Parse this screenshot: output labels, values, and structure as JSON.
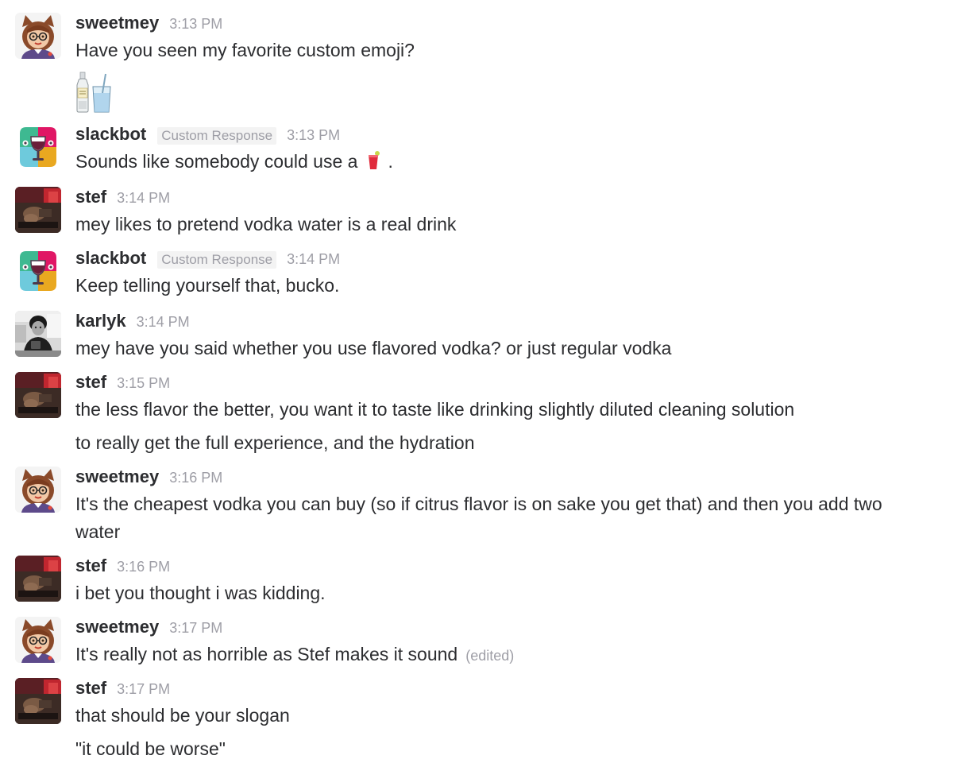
{
  "top_partial": {
    "text": ""
  },
  "messages": [
    {
      "author": "sweetmey",
      "time": "3:13 PM",
      "lines": [
        "Have you seen my favorite custom emoji?"
      ],
      "avatar_icon": "sweetmey-cat-avatar",
      "attachment_emoji": "vodka-water-emoji"
    },
    {
      "author": "slackbot",
      "badge": "Custom Response",
      "time": "3:13 PM",
      "text_before": "Sounds like somebody could use a",
      "inline_emoji": "cocktail-emoji",
      "text_after": ".",
      "avatar_icon": "slackbot-avatar"
    },
    {
      "author": "stef",
      "time": "3:14 PM",
      "lines": [
        "mey likes to pretend vodka water is a real drink"
      ],
      "avatar_icon": "stef-photo-avatar"
    },
    {
      "author": "slackbot",
      "badge": "Custom Response",
      "time": "3:14 PM",
      "lines": [
        "Keep telling yourself that, bucko."
      ],
      "avatar_icon": "slackbot-avatar"
    },
    {
      "author": "karlyk",
      "time": "3:14 PM",
      "lines": [
        "mey have you said whether you use flavored vodka? or just regular vodka"
      ],
      "avatar_icon": "karlyk-photo-avatar"
    },
    {
      "author": "stef",
      "time": "3:15 PM",
      "lines": [
        "the less flavor the better, you want it to taste like drinking slightly diluted cleaning solution",
        "to really get the full experience, and the hydration"
      ],
      "avatar_icon": "stef-photo-avatar"
    },
    {
      "author": "sweetmey",
      "time": "3:16 PM",
      "lines": [
        "It's the cheapest vodka you can buy (so if citrus flavor is on sake you get that) and then you add two",
        "water"
      ],
      "avatar_icon": "sweetmey-cat-avatar"
    },
    {
      "author": "stef",
      "time": "3:16 PM",
      "lines": [
        "i bet you thought i was kidding."
      ],
      "avatar_icon": "stef-photo-avatar"
    },
    {
      "author": "sweetmey",
      "time": "3:17 PM",
      "lines": [
        "It's really not as horrible as Stef makes it sound"
      ],
      "edited_label": "(edited)",
      "avatar_icon": "sweetmey-cat-avatar"
    },
    {
      "author": "stef",
      "time": "3:17 PM",
      "lines": [
        "that should be your slogan",
        "\"it could be worse\""
      ],
      "avatar_icon": "stef-photo-avatar"
    }
  ],
  "colors": {
    "text": "#2c2d30",
    "muted": "#9e9ea6",
    "badge_bg": "#f3f3f3",
    "background": "#ffffff"
  }
}
